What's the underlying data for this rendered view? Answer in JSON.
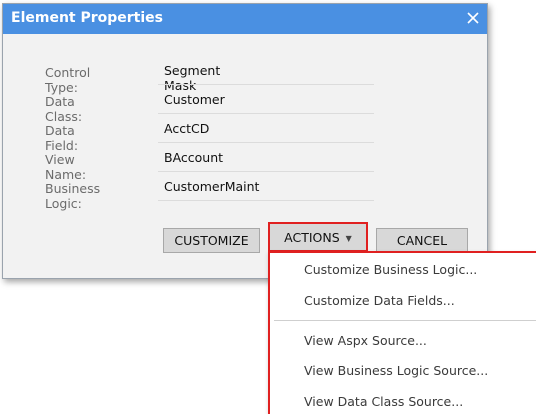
{
  "dialog": {
    "title": "Element Properties",
    "close_icon": "close-icon",
    "properties": [
      {
        "label": "Control Type:",
        "value": "Segment Mask"
      },
      {
        "label": "Data Class:",
        "value": "Customer"
      },
      {
        "label": "Data Field:",
        "value": "AcctCD"
      },
      {
        "label": "View Name:",
        "value": "BAccount"
      },
      {
        "label": "Business Logic:",
        "value": "CustomerMaint"
      }
    ],
    "buttons": {
      "customize": "CUSTOMIZE",
      "actions": "ACTIONS",
      "cancel": "CANCEL"
    }
  },
  "actions_menu": {
    "items": [
      "Customize Business Logic...",
      "Customize Data Fields...",
      "View Aspx Source...",
      "View Business Logic Source...",
      "View Data Class Source..."
    ]
  },
  "colors": {
    "title_bar": "#4a90e2",
    "highlight": "#e02020",
    "dialog_bg": "#f2f2f2",
    "button_bg": "#d8d8d8"
  }
}
